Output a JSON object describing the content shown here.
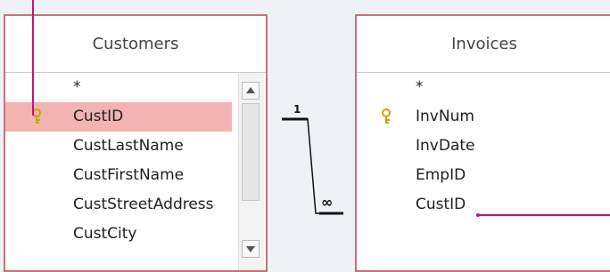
{
  "customers": {
    "title": "Customers",
    "fields": [
      {
        "label": "*",
        "key": false,
        "selected": false
      },
      {
        "label": "CustID",
        "key": true,
        "selected": true
      },
      {
        "label": "CustLastName",
        "key": false,
        "selected": false
      },
      {
        "label": "CustFirstName",
        "key": false,
        "selected": false
      },
      {
        "label": "CustStreetAddress",
        "key": false,
        "selected": false
      },
      {
        "label": "CustCity",
        "key": false,
        "selected": false
      }
    ]
  },
  "invoices": {
    "title": "Invoices",
    "fields": [
      {
        "label": "*",
        "key": false
      },
      {
        "label": "InvNum",
        "key": true
      },
      {
        "label": "InvDate",
        "key": false
      },
      {
        "label": "EmpID",
        "key": false
      },
      {
        "label": "CustID",
        "key": false
      }
    ]
  },
  "relationship": {
    "one_side_label": "1",
    "many_side_label": "∞"
  },
  "colors": {
    "callout_line": "#c0127f",
    "table_border": "#c8707c",
    "selected_row": "#f2b3b3",
    "key_icon": "#c9a400"
  },
  "icons": {
    "primary_key": "key-icon",
    "scroll_up": "scroll-up-arrow-icon",
    "scroll_down": "scroll-down-arrow-icon"
  }
}
